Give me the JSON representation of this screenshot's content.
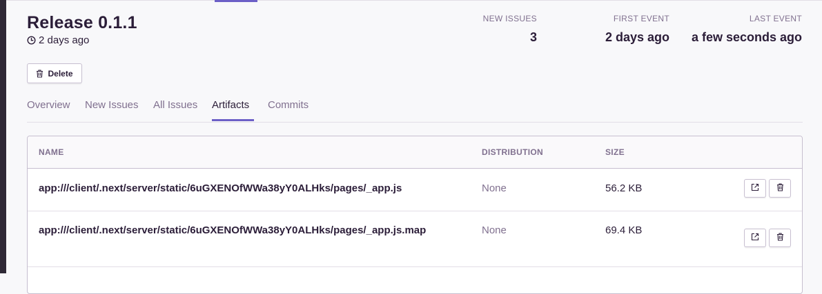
{
  "release": {
    "title": "Release 0.1.1",
    "date": "2 days ago"
  },
  "stats": {
    "new_issues_label": "NEW ISSUES",
    "new_issues_value": "3",
    "first_event_label": "FIRST EVENT",
    "first_event_value": "2 days ago",
    "last_event_label": "LAST EVENT",
    "last_event_value": "a few seconds ago"
  },
  "actions": {
    "delete_label": "Delete"
  },
  "tabs": [
    {
      "label": "Overview",
      "active": false
    },
    {
      "label": "New Issues",
      "active": false
    },
    {
      "label": "All Issues",
      "active": false
    },
    {
      "label": "Artifacts",
      "active": true
    },
    {
      "label": "Commits",
      "active": false
    }
  ],
  "table": {
    "headers": {
      "name": "NAME",
      "distribution": "DISTRIBUTION",
      "size": "SIZE"
    },
    "rows": [
      {
        "name": "app:///client/.next/server/static/6uGXENOfWWa38yY0ALHks/pages/_app.js",
        "distribution": "None",
        "size": "56.2 KB"
      },
      {
        "name": "app:///client/.next/server/static/6uGXENOfWWa38yY0ALHks/pages/_app.js.map",
        "distribution": "None",
        "size": "69.4 KB"
      }
    ]
  },
  "colors": {
    "accent": "#6c5fc7",
    "text_primary": "#2b1d38",
    "text_muted": "#80708f",
    "border": "#c6becf"
  },
  "icons": {
    "date": "clock-icon",
    "delete": "trash-icon",
    "open": "external-link-icon"
  }
}
